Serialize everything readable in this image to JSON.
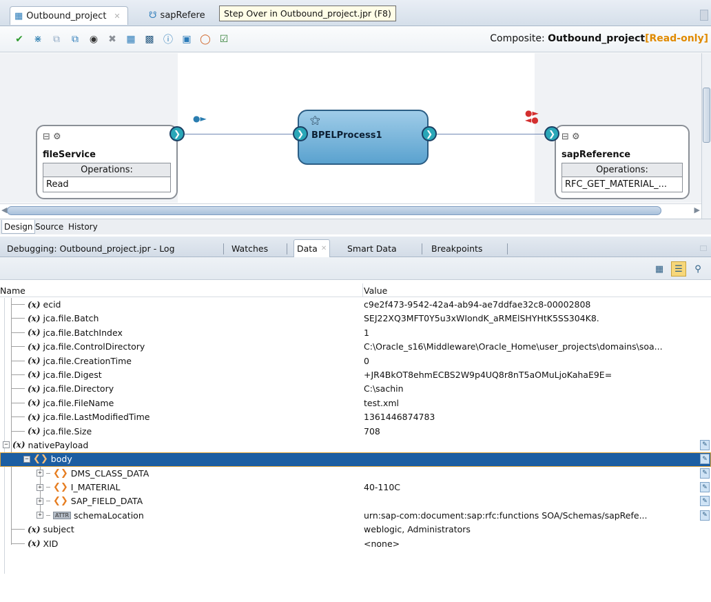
{
  "editor_tabs": [
    {
      "label": "Outbound_project",
      "icon": "composite-icon"
    },
    {
      "label": "sapRefere",
      "icon": "reference-icon"
    }
  ],
  "tooltip": "Step Over in Outbound_project.jpr (F8)",
  "composite": {
    "label": "Composite:",
    "name": "Outbound_project",
    "readonly": "[Read-only]"
  },
  "toolbar_icons": [
    "check-icon",
    "wireless-icon",
    "copy-icon",
    "layers-icon",
    "binoculars-icon",
    "delete-icon",
    "component-icon",
    "grid-icon",
    "info-icon",
    "window-icon",
    "bug-icon",
    "tasks-icon"
  ],
  "canvas": {
    "file_service": {
      "title": "fileService",
      "ops_label": "Operations:",
      "op": "Read"
    },
    "bpel": {
      "title": "BPELProcess1"
    },
    "sap_reference": {
      "title": "sapReference",
      "ops_label": "Operations:",
      "op": "RFC_GET_MATERIAL_..."
    }
  },
  "view_tabs": [
    "Design",
    "Source",
    "History"
  ],
  "debug_tabs": [
    "Debugging: Outbound_project.jpr - Log",
    "Watches",
    "Data",
    "Smart Data",
    "Breakpoints"
  ],
  "table": {
    "col_name": "Name",
    "col_value": "Value",
    "rows": [
      {
        "name": "ecid",
        "value": "c9e2f473-9542-42a4-ab94-ae7ddfae32c8-00002808"
      },
      {
        "name": "jca.file.Batch",
        "value": "SEJ22XQ3MFT0Y5u3xWIondK_aRMElSHYHtK5SS304K8."
      },
      {
        "name": "jca.file.BatchIndex",
        "value": "1"
      },
      {
        "name": "jca.file.ControlDirectory",
        "value": "C:\\Oracle_s16\\Middleware\\Oracle_Home\\user_projects\\domains\\soa..."
      },
      {
        "name": "jca.file.CreationTime",
        "value": "0"
      },
      {
        "name": "jca.file.Digest",
        "value": "+JR4BkOT8ehmECBS2W9p4UQ8r8nT5aOMuLjoKahaE9E="
      },
      {
        "name": "jca.file.Directory",
        "value": "C:\\sachin"
      },
      {
        "name": "jca.file.FileName",
        "value": "test.xml"
      },
      {
        "name": "jca.file.LastModifiedTime",
        "value": "1361446874783"
      },
      {
        "name": "jca.file.Size",
        "value": "708"
      },
      {
        "name": "nativePayload",
        "value": ""
      },
      {
        "name": "body",
        "value": ""
      },
      {
        "name": "DMS_CLASS_DATA",
        "value": ""
      },
      {
        "name": "I_MATERIAL",
        "value": "40-110C"
      },
      {
        "name": "SAP_FIELD_DATA",
        "value": ""
      },
      {
        "name": "schemaLocation",
        "value": "urn:sap-com:document:sap:rfc:functions SOA/Schemas/sapRefe..."
      },
      {
        "name": "subject",
        "value": "weblogic, Administrators"
      },
      {
        "name": "XID",
        "value": "<none>"
      }
    ]
  }
}
